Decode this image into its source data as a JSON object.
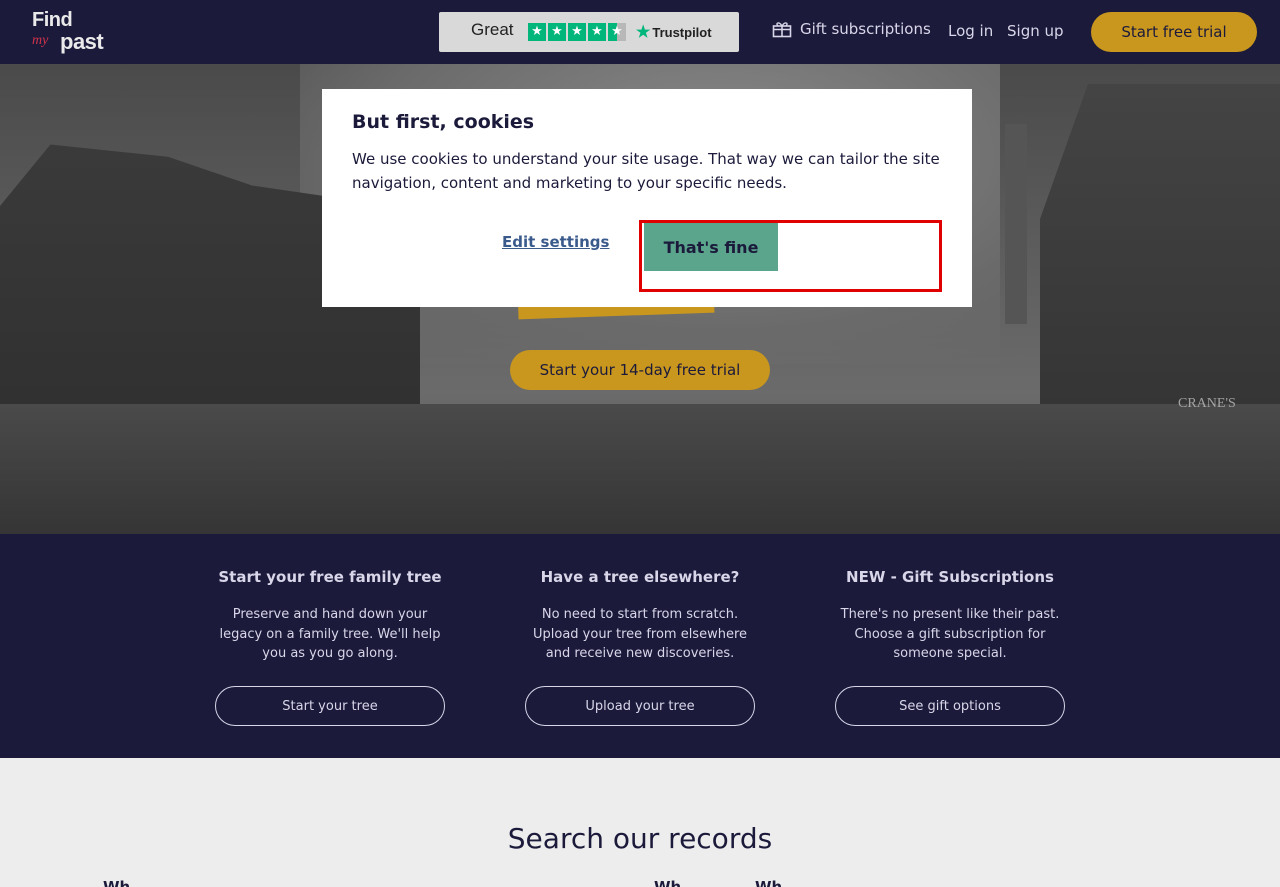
{
  "header": {
    "logo": {
      "line1": "Find",
      "line2": "my",
      "line3": "past"
    },
    "trustpilot": {
      "rating_text": "Great",
      "brand": "Trustpilot",
      "stars": 4.5
    },
    "nav": {
      "gift": "Gift subscriptions",
      "login": "Log in",
      "signup": "Sign up",
      "trial": "Start free trial"
    }
  },
  "hero": {
    "cta": "Start your 14-day free trial",
    "sign_text": "CRANE'S"
  },
  "cookie": {
    "title": "But first, cookies",
    "text": "We use cookies to understand your site usage. That way we can tailor the site navigation, content and marketing to your specific needs.",
    "edit_label": "Edit settings",
    "accept_label": "That's fine"
  },
  "features": [
    {
      "title": "Start your free family tree",
      "text": "Preserve and hand down your legacy on a family tree. We'll help you as you go along.",
      "button": "Start your tree"
    },
    {
      "title": "Have a tree elsewhere?",
      "text": "No need to start from scratch. Upload your tree from elsewhere and receive new discoveries.",
      "button": "Upload your tree"
    },
    {
      "title": "NEW - Gift Subscriptions",
      "text": "There's no present like their past. Choose a gift subscription for someone special.",
      "button": "See gift options"
    }
  ],
  "search": {
    "title": "Search our records",
    "labels": [
      "Wh",
      "Wh",
      "Wh"
    ]
  },
  "colors": {
    "navy": "#1b1a3b",
    "gold": "#c9971e",
    "teal": "#5aa58c",
    "highlight": "#e00000"
  }
}
